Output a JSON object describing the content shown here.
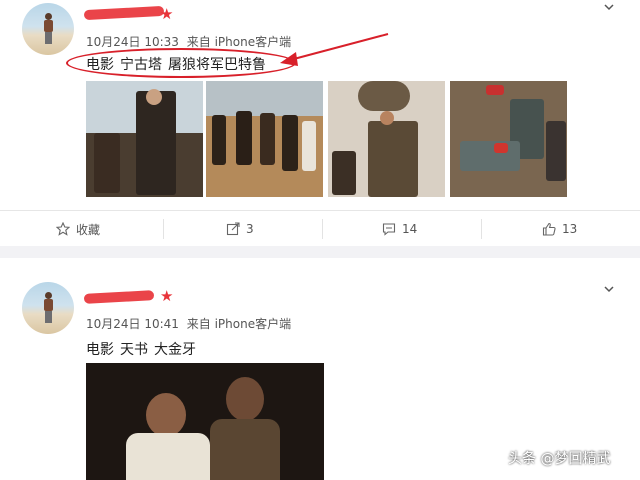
{
  "posts": [
    {
      "meta": {
        "time": "10月24日 10:33",
        "source": "来自 iPhone客户端"
      },
      "text": {
        "part1": "电影",
        "part2": "宁古塔",
        "part3": "屠狼将军巴特鲁"
      },
      "actions": {
        "favorite": "收藏",
        "repost": "3",
        "comment": "14",
        "like": "13"
      }
    },
    {
      "meta": {
        "time": "10月24日 10:41",
        "source": "来自 iPhone客户端"
      },
      "text": {
        "part1": "电影",
        "part2": "天书",
        "part3": "大金牙"
      }
    }
  ],
  "watermark": "头条 @梦回精武",
  "colors": {
    "annotation_red": "#d8202a",
    "redact_red": "#e8343a",
    "background": "#f2f2f5"
  }
}
